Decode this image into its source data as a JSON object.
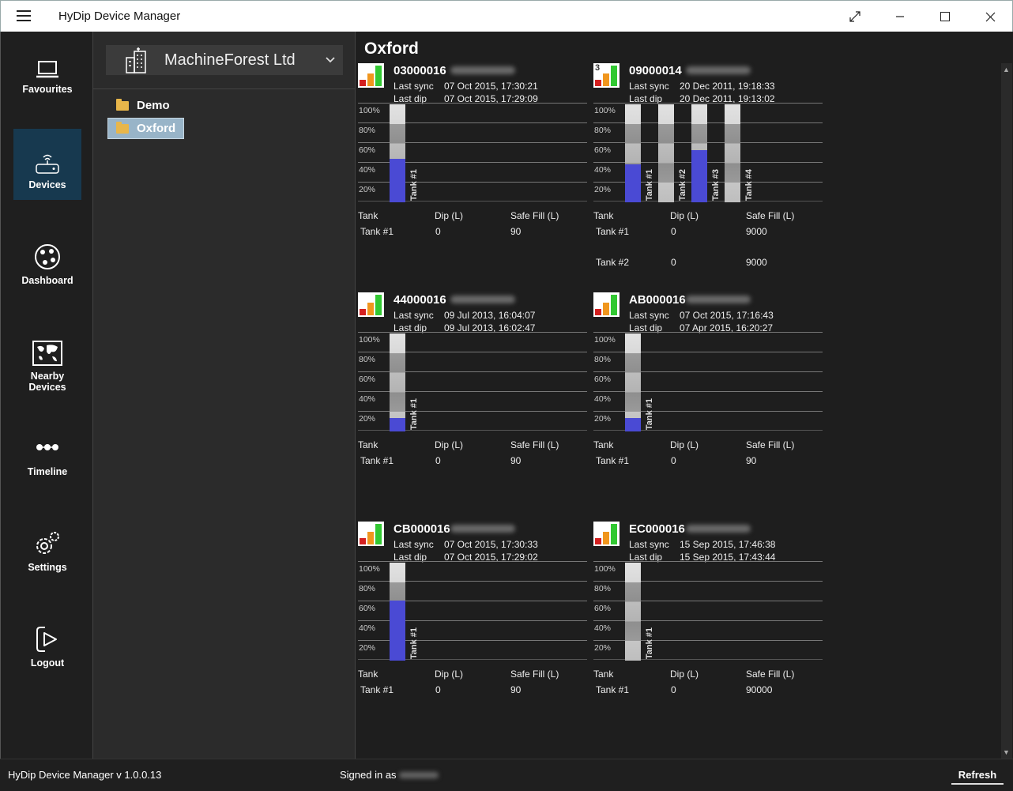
{
  "window": {
    "title": "HyDip Device Manager",
    "colors": {
      "accent": "#17394f",
      "tank_fill": "#4a4ad4",
      "selected_folder": "#98b4c8"
    }
  },
  "nav": {
    "items": [
      {
        "label": "Favourites",
        "icon": "laptop-icon"
      },
      {
        "label": "Devices",
        "icon": "router-icon",
        "active": true
      },
      {
        "label": "Dashboard",
        "icon": "dashboard-icon"
      },
      {
        "label": "Nearby Devices",
        "icon": "map-icon"
      },
      {
        "label": "Timeline",
        "icon": "timeline-icon"
      },
      {
        "label": "Settings",
        "icon": "gear-icon"
      },
      {
        "label": "Logout",
        "icon": "logout-icon"
      }
    ]
  },
  "sidebar": {
    "organisation": "MachineForest Ltd",
    "folders": [
      {
        "label": "Demo",
        "selected": false
      },
      {
        "label": "Oxford",
        "selected": true
      }
    ]
  },
  "main": {
    "title": "Oxford",
    "grid_ticks": [
      "100%",
      "80%",
      "60%",
      "40%",
      "20%"
    ],
    "table_headers": {
      "tank": "Tank",
      "dip": "Dip (L)",
      "safe_fill": "Safe Fill (L)"
    },
    "sync_label": "Last sync",
    "dip_label": "Last dip",
    "devices": [
      {
        "serial": "03000016",
        "last_sync": "07 Oct 2015, 17:30:21",
        "last_dip": "07 Oct 2015, 17:29:09",
        "tanks": [
          {
            "label": "Tank #1",
            "level": 0.44
          }
        ],
        "rows": [
          {
            "tank": "Tank #1",
            "dip": "0",
            "safe_fill": "90"
          }
        ]
      },
      {
        "serial": "09000014",
        "last_sync": "20 Dec 2011, 19:18:33",
        "last_dip": "20 Dec 2011, 19:13:02",
        "logo_badge": "3",
        "tanks": [
          {
            "label": "Tank #1",
            "level": 0.39
          },
          {
            "label": "Tank #2",
            "level": 0
          },
          {
            "label": "Tank #3",
            "level": 0.53
          },
          {
            "label": "Tank #4",
            "level": 0
          }
        ],
        "rows": [
          {
            "tank": "Tank #1",
            "dip": "0",
            "safe_fill": "9000"
          },
          {
            "tank": "Tank #2",
            "dip": "0",
            "safe_fill": "9000"
          }
        ]
      },
      {
        "serial": "44000016",
        "last_sync": "09 Jul 2013, 16:04:07",
        "last_dip": "09 Jul 2013, 16:02:47",
        "tanks": [
          {
            "label": "Tank #1",
            "level": 0.14
          }
        ],
        "rows": [
          {
            "tank": "Tank #1",
            "dip": "0",
            "safe_fill": "90"
          }
        ]
      },
      {
        "serial": "AB000016",
        "last_sync": "07 Oct 2015, 17:16:43",
        "last_dip": "07 Apr 2015, 16:20:27",
        "tanks": [
          {
            "label": "Tank #1",
            "level": 0.14
          }
        ],
        "rows": [
          {
            "tank": "Tank #1",
            "dip": "0",
            "safe_fill": "90"
          }
        ]
      },
      {
        "serial": "CB000016",
        "last_sync": "07 Oct 2015, 17:30:33",
        "last_dip": "07 Oct 2015, 17:29:02",
        "tanks": [
          {
            "label": "Tank #1",
            "level": 0.61
          }
        ],
        "rows": [
          {
            "tank": "Tank #1",
            "dip": "0",
            "safe_fill": "90"
          }
        ]
      },
      {
        "serial": "EC000016",
        "last_sync": "15 Sep 2015, 17:46:38",
        "last_dip": "15 Sep 2015, 17:43:44",
        "tanks": [
          {
            "label": "Tank #1",
            "level": 0
          }
        ],
        "rows": [
          {
            "tank": "Tank #1",
            "dip": "0",
            "safe_fill": "90000"
          }
        ]
      }
    ]
  },
  "status": {
    "version": "HyDip Device Manager v 1.0.0.13",
    "signed_in": "Signed in as",
    "refresh_label": "Refresh"
  }
}
